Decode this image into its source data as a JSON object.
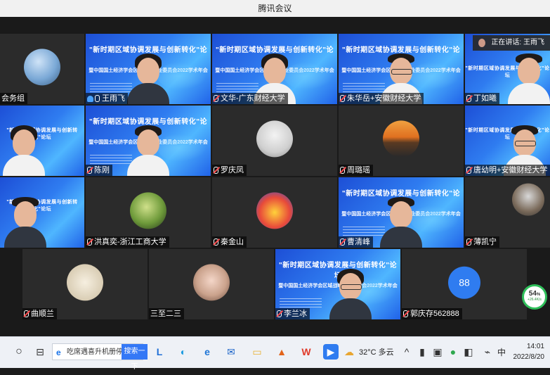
{
  "window": {
    "title": "腾讯会议"
  },
  "speaking": {
    "label": "正在讲话: 王雨飞"
  },
  "banner": {
    "line1": "\"新时期区域协调发展与创新转化\"论坛",
    "line2": "暨中国国土经济学会区域战略专业委员会2022学术年会"
  },
  "participants": [
    {
      "name": "会务组",
      "type": "avatar",
      "mic": "none"
    },
    {
      "name": "王雨飞",
      "type": "video",
      "mic": "on",
      "host": true
    },
    {
      "name": "文华-广东财经大学",
      "type": "video",
      "mic": "muted"
    },
    {
      "name": "朱华岳+安徽财经大学",
      "type": "video",
      "mic": "muted"
    },
    {
      "name": "丁如曦",
      "type": "video",
      "mic": "muted"
    },
    {
      "name": "",
      "type": "video",
      "mic": "none"
    },
    {
      "name": "陈刚",
      "type": "video",
      "mic": "muted"
    },
    {
      "name": "罗庆凤",
      "type": "avatar",
      "mic": "muted"
    },
    {
      "name": "周璐瑶",
      "type": "avatar",
      "mic": "muted"
    },
    {
      "name": "唐幼明+安徽财经大学",
      "type": "video",
      "mic": "muted"
    },
    {
      "name": "",
      "type": "video",
      "mic": "none"
    },
    {
      "name": "洪真奕-浙江工商大学",
      "type": "avatar",
      "mic": "muted"
    },
    {
      "name": "秦金山",
      "type": "avatar",
      "mic": "muted"
    },
    {
      "name": "曹清峰",
      "type": "video",
      "mic": "muted"
    },
    {
      "name": "薄凯宁",
      "type": "avatar",
      "mic": "muted"
    },
    {
      "name": "曲顺兰",
      "type": "avatar",
      "mic": "muted"
    },
    {
      "name": "三至二三",
      "type": "avatar",
      "mic": "none"
    },
    {
      "name": "李兰冰",
      "type": "video",
      "mic": "muted"
    },
    {
      "name": "郭庆存562888",
      "type": "initials",
      "initials": "88",
      "mic": "muted"
    }
  ],
  "network": {
    "percent": "54",
    "unit": "%",
    "speed": "+26.4K/s"
  },
  "taskbar": {
    "search_text": "吃席遇喜升机册停",
    "search_button": "搜索一下",
    "weather": "32°C 多云",
    "ime": "中",
    "time": "14:01",
    "date": "2022/8/20"
  }
}
